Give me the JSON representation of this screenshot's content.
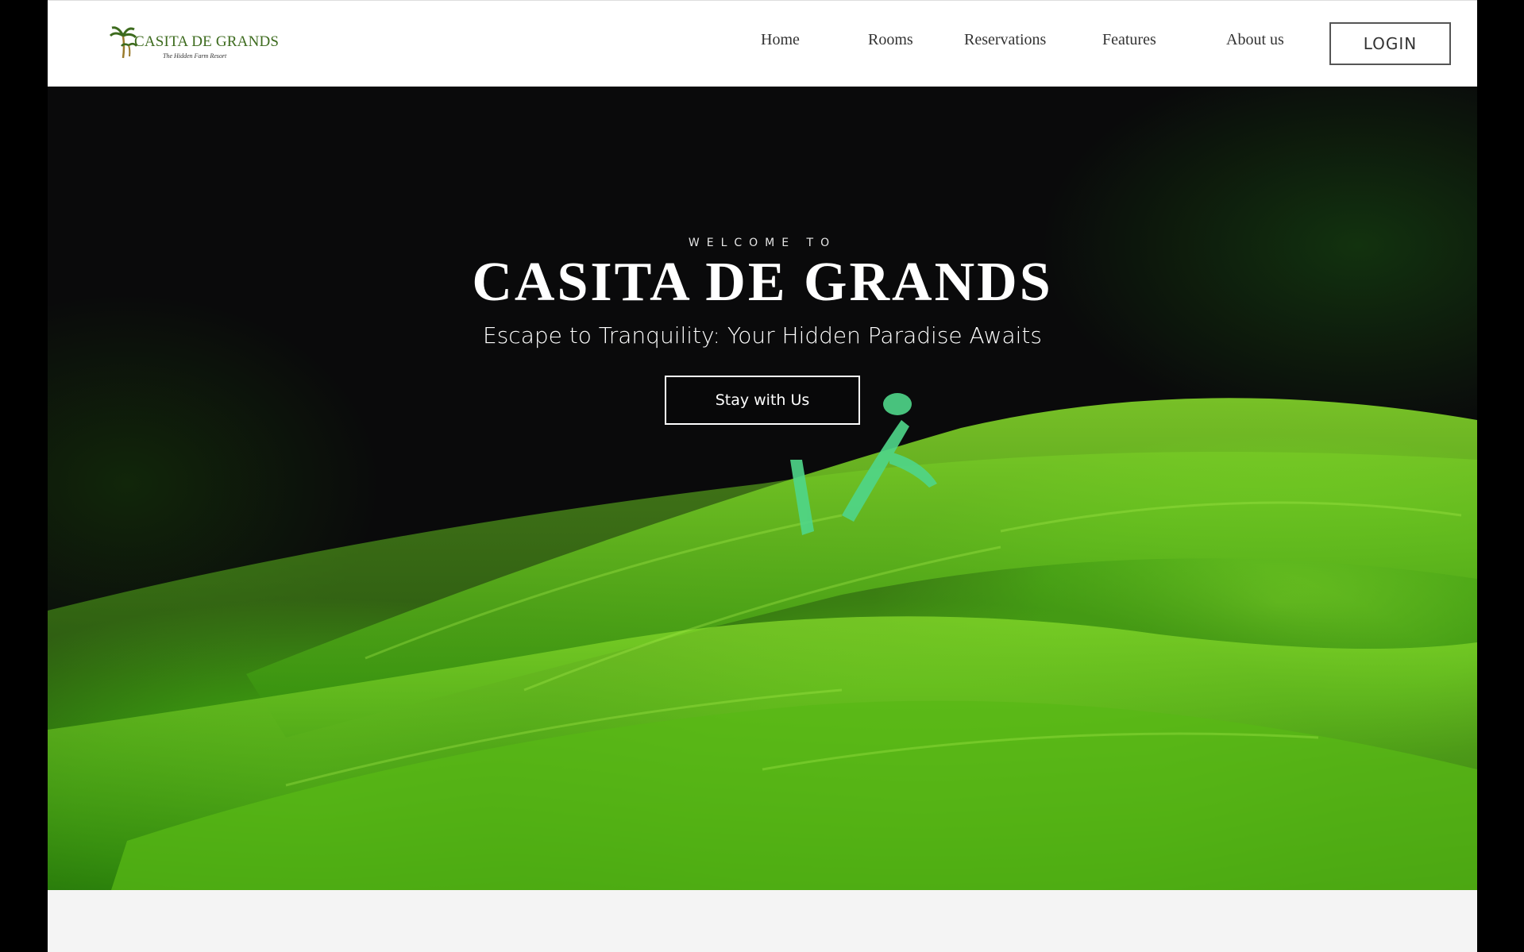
{
  "brand": {
    "name": "CASITA DE GRANDS",
    "tagline": "The Hidden Farm Resort",
    "logo_icon": "palm-tree-crescent-icon",
    "accent_color": "#3d6b1e",
    "gold_color": "#9a7b2c"
  },
  "nav": {
    "items": [
      {
        "label": "Home"
      },
      {
        "label": "Rooms"
      },
      {
        "label": "Reservations"
      },
      {
        "label": "Features"
      },
      {
        "label": "About us"
      }
    ],
    "login_label": "LOGIN"
  },
  "hero": {
    "eyebrow": "WELCOME TO",
    "title": "CASITA DE GRANDS",
    "subtitle": "Escape to Tranquility: Your Hidden Paradise Awaits",
    "cta_label": "Stay with Us",
    "background_image": "green-fern-with-praying-mantis"
  }
}
